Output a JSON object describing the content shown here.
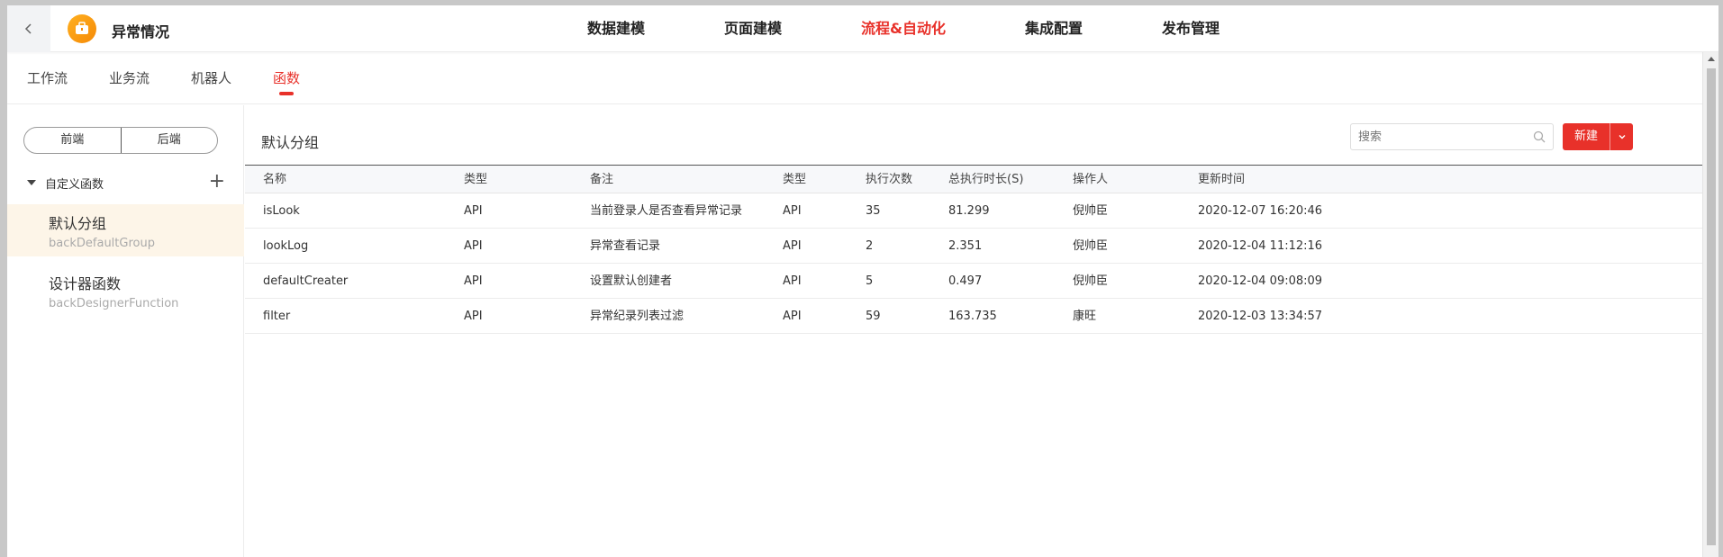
{
  "header": {
    "back_icon": "chevron-left-icon",
    "app_icon": "briefcase-icon",
    "app_title": "异常情况",
    "nav": [
      {
        "label": "数据建模",
        "active": false
      },
      {
        "label": "页面建模",
        "active": false
      },
      {
        "label": "流程&自动化",
        "active": true
      },
      {
        "label": "集成配置",
        "active": false
      },
      {
        "label": "发布管理",
        "active": false
      }
    ],
    "accent_color": "#e8312a"
  },
  "subtabs": [
    {
      "label": "工作流",
      "active": false
    },
    {
      "label": "业务流",
      "active": false
    },
    {
      "label": "机器人",
      "active": false
    },
    {
      "label": "函数",
      "active": true
    }
  ],
  "sidebar": {
    "segment": {
      "left": "前端",
      "right": "后端",
      "selected": "后端"
    },
    "section_label": "自定义函数",
    "add_icon": "plus-icon",
    "groups": [
      {
        "name": "默认分组",
        "code": "backDefaultGroup",
        "selected": true
      },
      {
        "name": "设计器函数",
        "code": "backDesignerFunction",
        "selected": false
      }
    ]
  },
  "main": {
    "title": "默认分组",
    "search_placeholder": "搜索",
    "new_button": "新建",
    "table": {
      "columns": [
        "名称",
        "类型",
        "备注",
        "类型",
        "执行次数",
        "总执行时长(S)",
        "操作人",
        "更新时间"
      ],
      "rows": [
        [
          "isLook",
          "API",
          "当前登录人是否查看异常记录",
          "API",
          "35",
          "81.299",
          "倪帅臣",
          "2020-12-07 16:20:46"
        ],
        [
          "lookLog",
          "API",
          "异常查看记录",
          "API",
          "2",
          "2.351",
          "倪帅臣",
          "2020-12-04 11:12:16"
        ],
        [
          "defaultCreater",
          "API",
          "设置默认创建者",
          "API",
          "5",
          "0.497",
          "倪帅臣",
          "2020-12-04 09:08:09"
        ],
        [
          "filter",
          "API",
          "异常纪录列表过滤",
          "API",
          "59",
          "163.735",
          "康旺",
          "2020-12-03 13:34:57"
        ]
      ]
    }
  }
}
